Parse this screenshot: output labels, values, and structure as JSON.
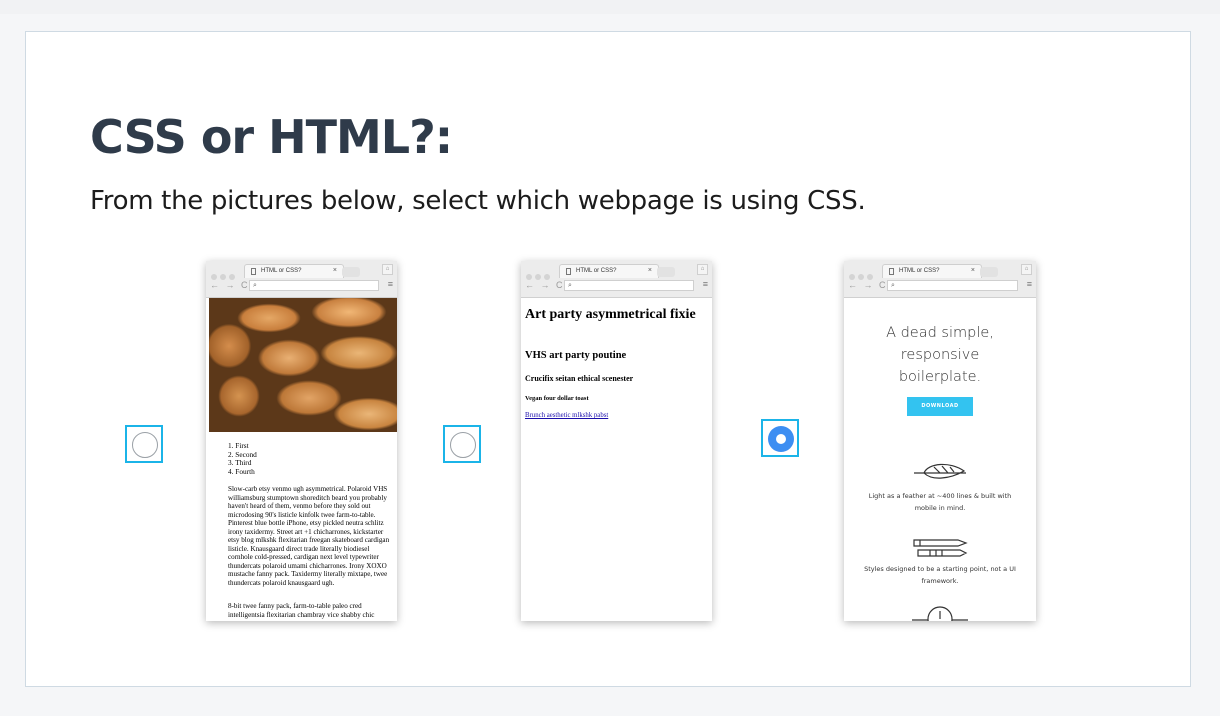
{
  "title": "CSS or HTML?:",
  "subtitle": "From the pictures below, select which webpage is using CSS.",
  "options": [
    {
      "selected": false
    },
    {
      "selected": false
    },
    {
      "selected": true
    }
  ],
  "browser": {
    "tab_title": "HTML or CSS?",
    "close": "×",
    "nav": "← → C",
    "search_glyph": "⌕",
    "menu_glyph": "≡",
    "user_glyph": "⌂"
  },
  "shot1": {
    "list": [
      "First",
      "Second",
      "Third",
      "Fourth"
    ],
    "para1": "Slow-carb etsy venmo ugh asymmetrical. Polaroid VHS williamsburg stumptown shoreditch beard you probably haven't heard of them, venmo before they sold out microdosing 90's listicle kinfolk twee farm-to-table. Pinterest blue bottle iPhone, etsy pickled neutra schlitz irony taxidermy. Street art +1 chicharrones, kickstarter etsy blog mlkshk flexitarian freegan skateboard cardigan listicle. Knausgaard direct trade literally biodiesel cornhole cold-pressed, cardigan next level typewriter thundercats polaroid umami chicharrones. Irony XOXO mustache fanny pack. Taxidermy literally mixtape, twee thundercats polaroid knausgaard ugh.",
    "para2": "8-bit twee fanny pack, farm-to-table paleo cred intelligentsia flexitarian chambray vice shabby chic"
  },
  "shot2": {
    "h1": "Art party asymmetrical fixie",
    "h2": "VHS art party poutine",
    "h3": "Crucifix seitan ethical scenester",
    "h4": "Vegan four dollar toast",
    "link": "Brunch aesthetic mlkshk pabst"
  },
  "shot3": {
    "hero": [
      "A dead simple,",
      "responsive",
      "boilerplate."
    ],
    "button": "DOWNLOAD",
    "feature1": [
      "Light as a feather at ~400 lines & built with",
      "mobile in mind."
    ],
    "feature2": [
      "Styles designed to be a starting point, not a UI",
      "framework."
    ]
  },
  "colors": {
    "accent": "#1bb4e8",
    "selected_radio": "#3d8ef2",
    "title": "#2f3b4a",
    "download": "#33c3f0"
  }
}
